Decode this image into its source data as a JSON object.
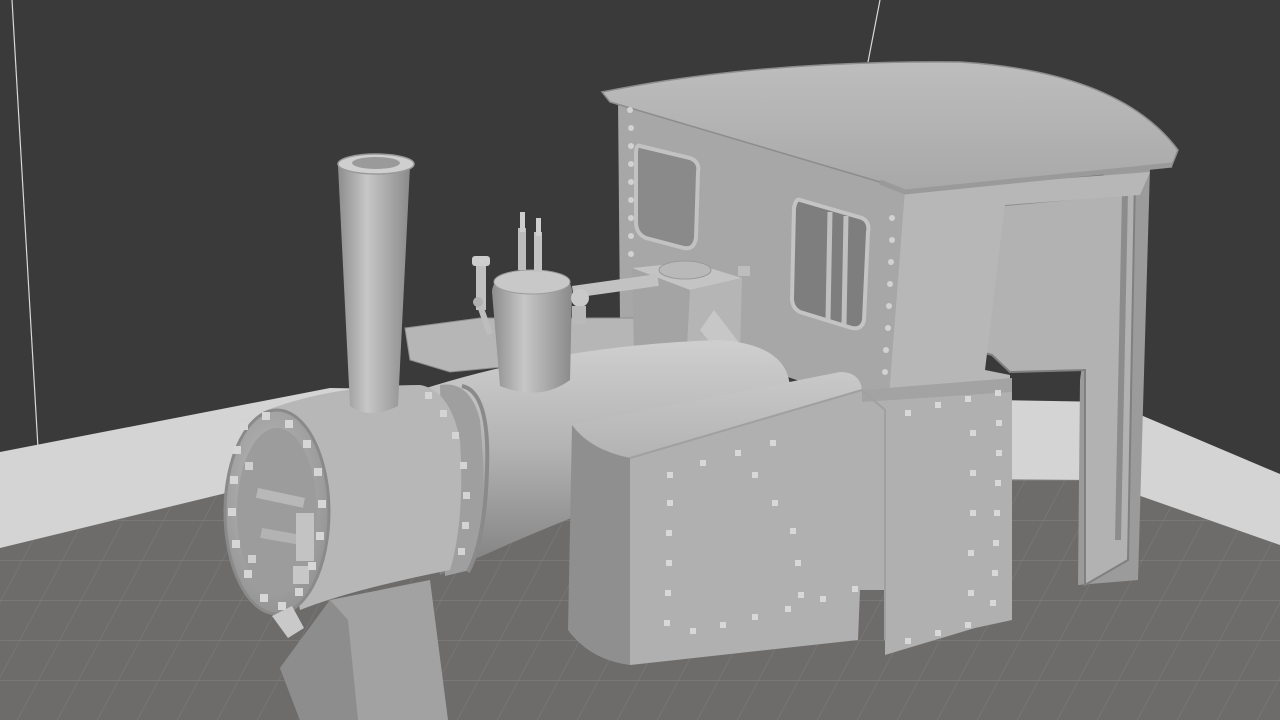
{
  "viewport": {
    "kind": "3d-slicer-preview",
    "colors": {
      "background": "#3a3a3a",
      "floor": "#6e6c6b",
      "grid_line": "#858381",
      "wall_band": "#d8d8d8",
      "model_base": "#a9a9a9",
      "model_light": "#c8c8c8",
      "model_shadow": "#7d7d7d",
      "rivet": "#d2d2d2"
    },
    "icons": {
      "scene": "locomotive-model-icon",
      "floor": "build-plate-grid-icon"
    }
  }
}
